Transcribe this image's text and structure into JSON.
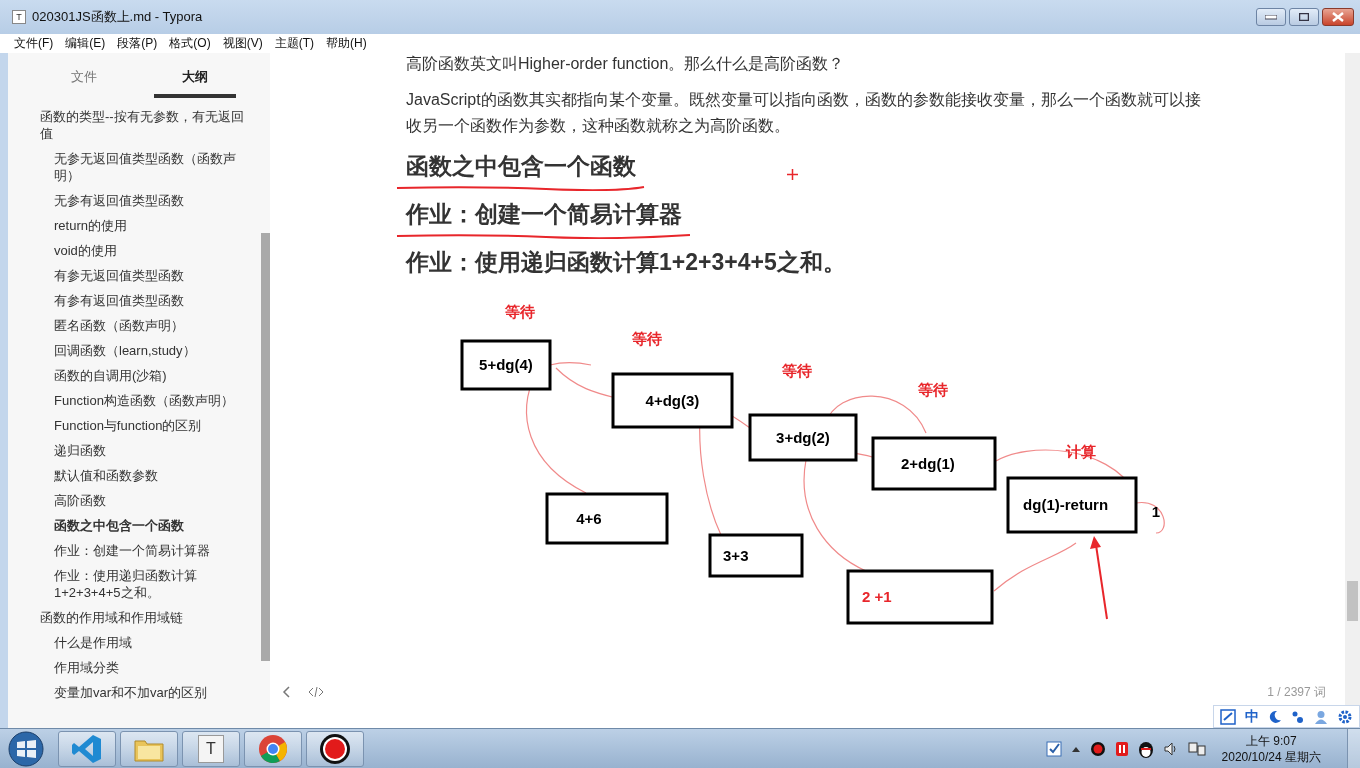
{
  "window": {
    "title": "020301JS函数上.md - Typora",
    "icon_glyph": "T"
  },
  "menu": [
    "文件(F)",
    "编辑(E)",
    "段落(P)",
    "格式(O)",
    "视图(V)",
    "主题(T)",
    "帮助(H)"
  ],
  "sidebar": {
    "tabs": [
      {
        "label": "文件",
        "selected": false
      },
      {
        "label": "大纲",
        "selected": true
      }
    ],
    "outline": [
      {
        "label": "函数的类型--按有无参数，有无返回值",
        "selected": false,
        "children": [
          {
            "label": "无参无返回值类型函数（函数声明）",
            "selected": false
          },
          {
            "label": "无参有返回值类型函数",
            "selected": false
          },
          {
            "label": "return的使用",
            "selected": false
          },
          {
            "label": "void的使用",
            "selected": false
          },
          {
            "label": "有参无返回值类型函数",
            "selected": false
          },
          {
            "label": "有参有返回值类型函数",
            "selected": false
          },
          {
            "label": "匿名函数（函数声明）",
            "selected": false
          },
          {
            "label": "回调函数（learn,study）",
            "selected": false
          },
          {
            "label": "函数的自调用(沙箱)",
            "selected": false
          },
          {
            "label": "Function构造函数（函数声明）",
            "selected": false
          },
          {
            "label": "Function与function的区别",
            "selected": false
          },
          {
            "label": "递归函数",
            "selected": false
          },
          {
            "label": "默认值和函数参数",
            "selected": false
          },
          {
            "label": "高阶函数",
            "selected": false
          },
          {
            "label": "函数之中包含一个函数",
            "selected": true
          },
          {
            "label": "作业：创建一个简易计算器",
            "selected": false
          },
          {
            "label": "作业：使用递归函数计算1+2+3+4+5之和。",
            "selected": false
          }
        ]
      },
      {
        "label": "函数的作用域和作用域链",
        "selected": false,
        "children": [
          {
            "label": "什么是作用域",
            "selected": false
          },
          {
            "label": "作用域分类",
            "selected": false
          },
          {
            "label": "变量加var和不加var的区别",
            "selected": false
          }
        ]
      }
    ]
  },
  "document": {
    "blocks": [
      {
        "kind": "paragraph",
        "text": "高阶函数英文叫Higher-order function。那么什么是高阶函数？"
      },
      {
        "kind": "paragraph",
        "text": "JavaScript的函数其实都指向某个变量。既然变量可以指向函数，函数的参数能接收变量，那么一个函数就可以接收另一个函数作为参数，这种函数就称之为高阶函数。"
      },
      {
        "kind": "heading",
        "text": "函数之中包含一个函数",
        "underlined": true
      },
      {
        "kind": "heading",
        "text": "作业：创建一个简易计算器",
        "underlined": true
      },
      {
        "kind": "heading",
        "text": "作业：使用递归函数计算1+2+3+4+5之和。",
        "underlined": false
      },
      {
        "kind": "diagram",
        "nodes": [
          {
            "label": "5+dg(4)",
            "color": "#000000"
          },
          {
            "label": "4+dg(3)",
            "color": "#000000"
          },
          {
            "label": "3+dg(2)",
            "color": "#000000"
          },
          {
            "label": "2+dg(1)",
            "color": "#000000"
          },
          {
            "label": "dg(1)-return",
            "color": "#000000"
          },
          {
            "label": "4+6",
            "color": "#000000"
          },
          {
            "label": "3+3",
            "color": "#000000"
          },
          {
            "label": "2 +1",
            "color": "#e8262b"
          }
        ],
        "notes": [
          {
            "label": "等待",
            "color": "#e8262b"
          },
          {
            "label": "等待",
            "color": "#e8262b"
          },
          {
            "label": "等待",
            "color": "#e8262b"
          },
          {
            "label": "等待",
            "color": "#e8262b"
          },
          {
            "label": "计算",
            "color": "#e8262b"
          },
          {
            "label": "1",
            "color": "#000000"
          }
        ]
      }
    ],
    "word_count": "1 / 2397 词"
  },
  "taskbar": {
    "apps": [
      {
        "kind": "vscode"
      },
      {
        "kind": "folder"
      },
      {
        "kind": "typora",
        "glyph": "T"
      },
      {
        "kind": "chrome"
      },
      {
        "kind": "recorder"
      }
    ],
    "ime": {
      "mode": "中"
    },
    "clock": {
      "time": "上午 9:07",
      "date": "2020/10/24 星期六"
    }
  }
}
